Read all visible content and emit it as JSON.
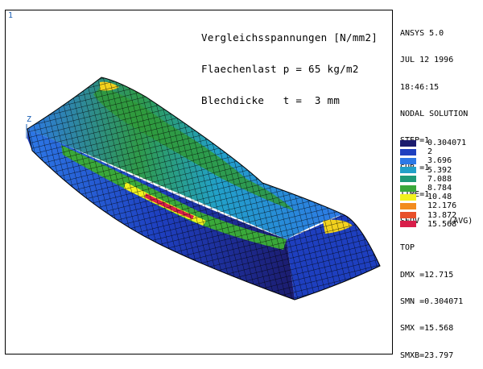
{
  "window_number": "1",
  "title_lines": [
    "Vergleichsspannungen [N/mm2]",
    "Flaechenlast p = 65 kg/m2",
    "Blechdicke   t =  3 mm"
  ],
  "axis_label": "Z",
  "info_lines": [
    "ANSYS 5.0",
    "JUL 12 1996",
    "18:46:15",
    "NODAL SOLUTION",
    "STEP=1",
    "SUB =1",
    "TIME=1",
    "SEQV      (AVG)",
    "TOP",
    "DMX =12.715",
    "SMN =0.304071",
    "SMX =15.568",
    "SMXB=23.797"
  ],
  "legend": [
    {
      "value": "0.304071",
      "color": "#1c1c6e"
    },
    {
      "value": "2",
      "color": "#1e3fbf"
    },
    {
      "value": "3.696",
      "color": "#2d78e6"
    },
    {
      "value": "5.392",
      "color": "#22a0c8"
    },
    {
      "value": "7.088",
      "color": "#1f9a78"
    },
    {
      "value": "8.784",
      "color": "#3aa83a"
    },
    {
      "value": "10.48",
      "color": "#f2f21e"
    },
    {
      "value": "12.176",
      "color": "#f28c1e"
    },
    {
      "value": "13.872",
      "color": "#e8502a"
    },
    {
      "value": "15.568",
      "color": "#d81e4a"
    }
  ]
}
